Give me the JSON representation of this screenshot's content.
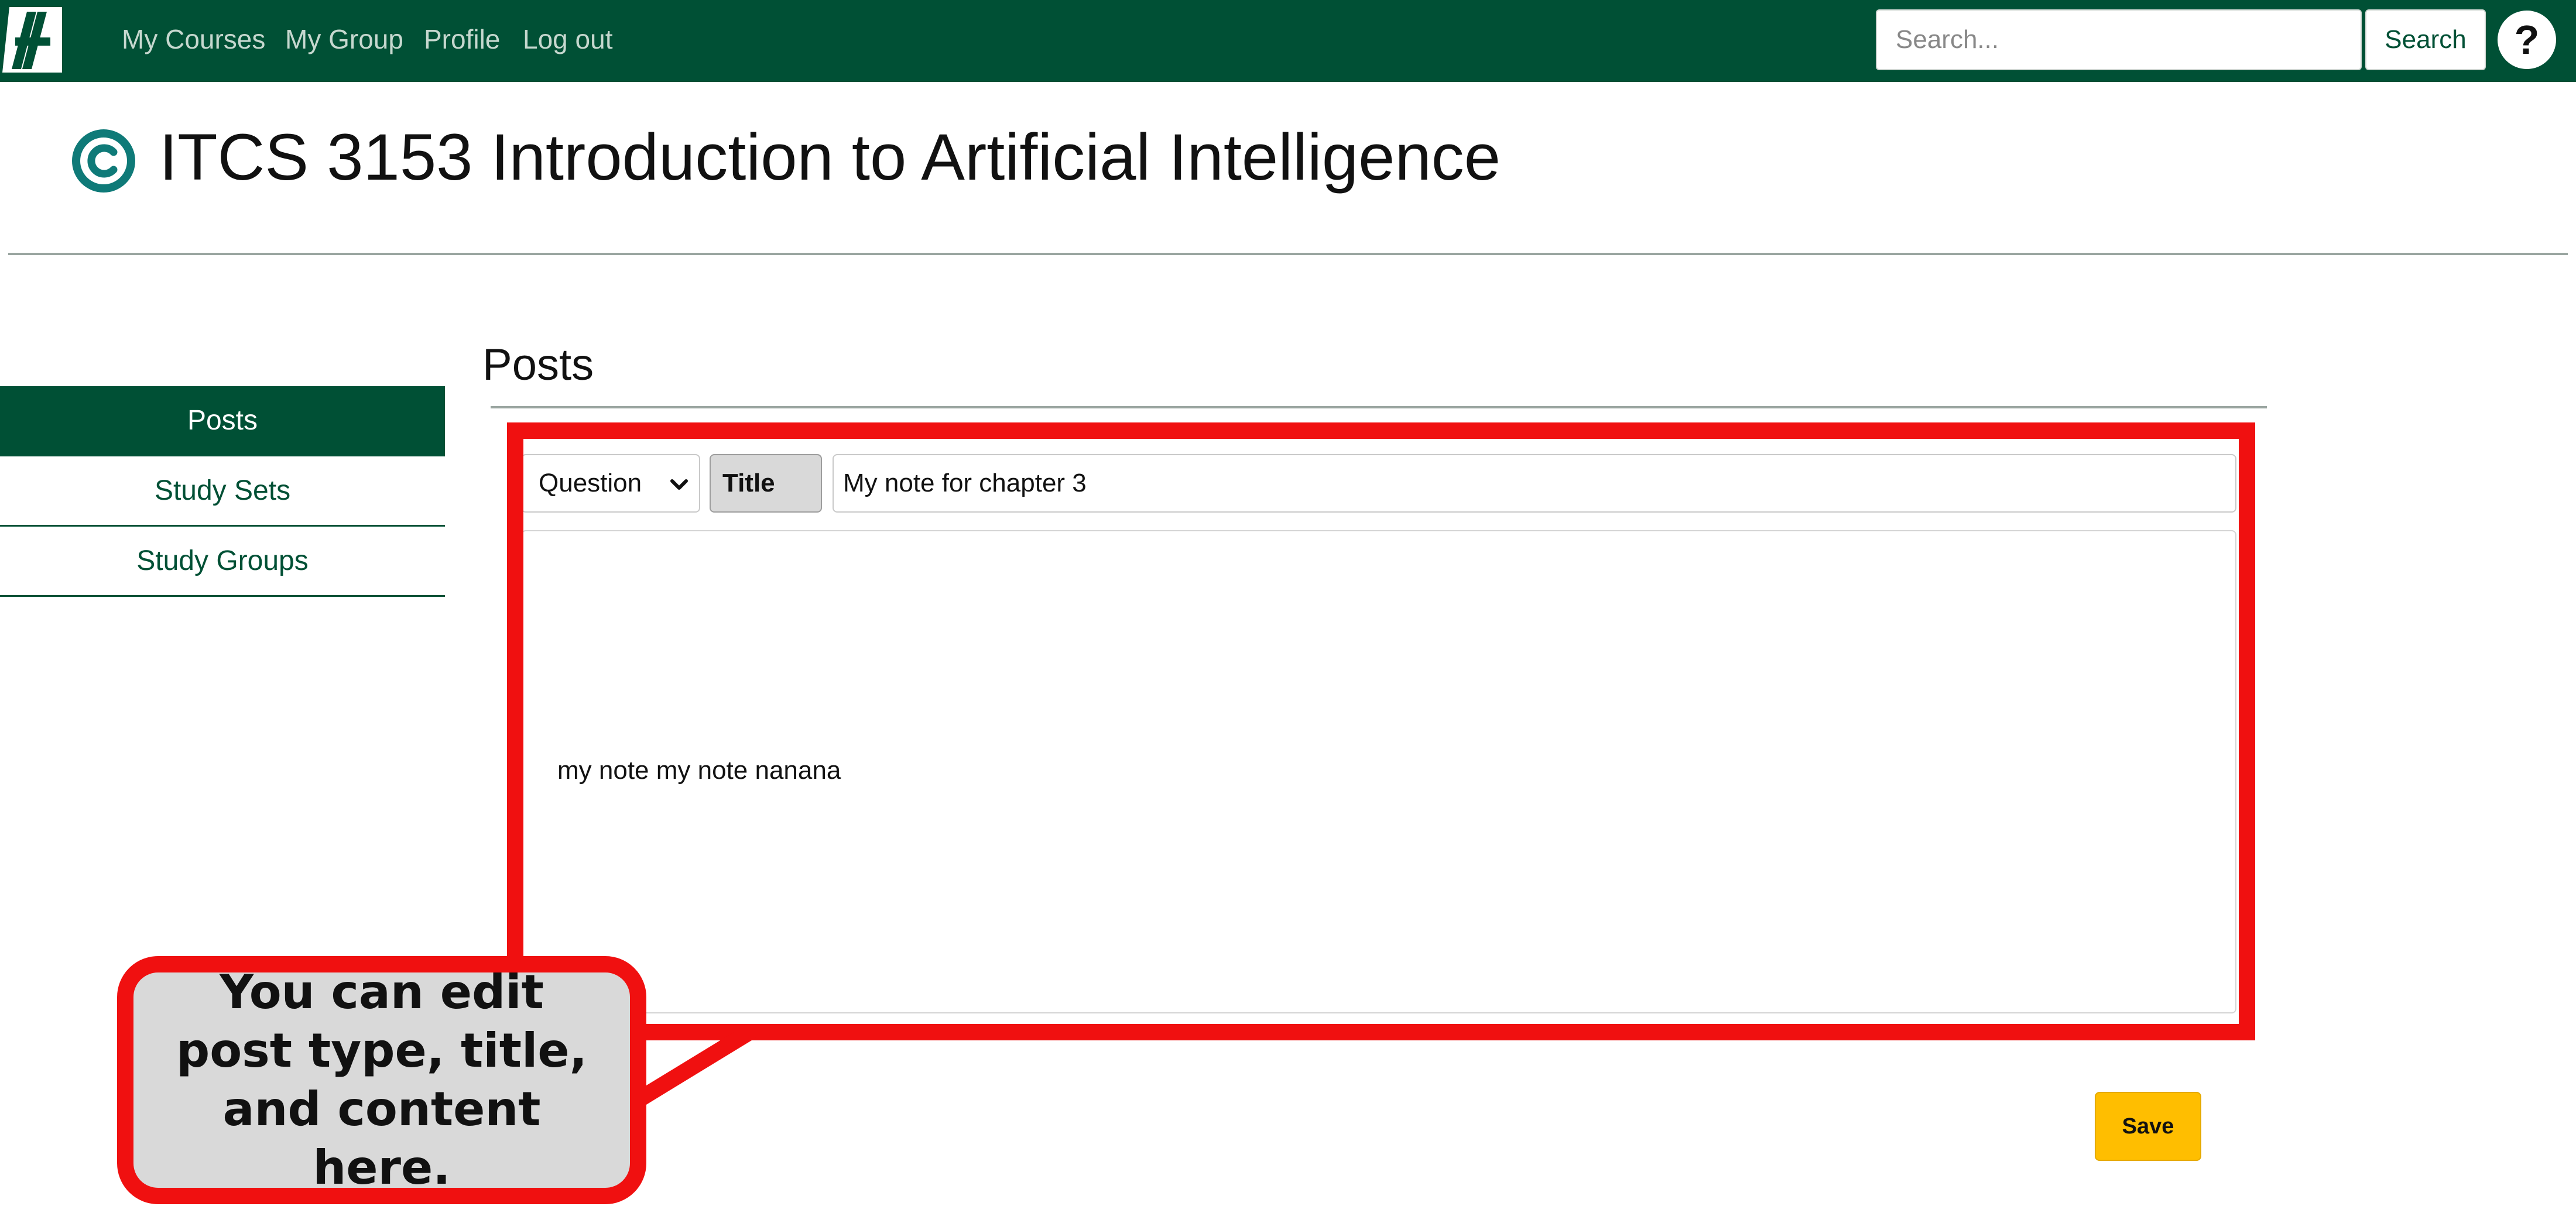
{
  "nav": {
    "links": [
      "My Courses",
      "My Group",
      "Profile",
      "Log out"
    ],
    "search_placeholder": "Search...",
    "search_button": "Search",
    "help_icon": "question-mark-icon",
    "brand_color": "#005035"
  },
  "course": {
    "icon": "copyright-circle-icon",
    "title": "ITCS 3153 Introduction to Artificial Intelligence"
  },
  "sidebar": {
    "items": [
      {
        "label": "Posts",
        "active": true
      },
      {
        "label": "Study Sets",
        "active": false
      },
      {
        "label": "Study Groups",
        "active": false
      }
    ]
  },
  "main": {
    "section_title": "Posts",
    "post_type": "Question",
    "title_label": "Title",
    "title_value": "My note for chapter 3",
    "content": "my note my note nanana",
    "save_label": "Save",
    "save_color": "#ffbe00"
  },
  "annotation": {
    "callout_text": "You can edit post type, title, and content here.",
    "highlight_color": "#f01010"
  }
}
